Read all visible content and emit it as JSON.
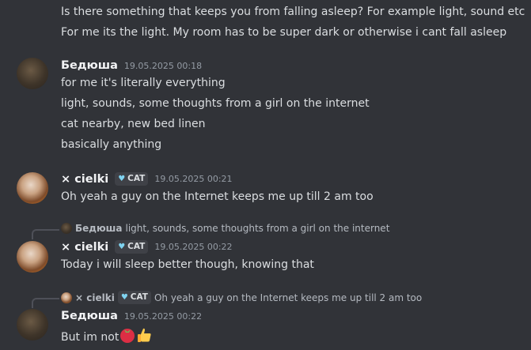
{
  "messages": {
    "top_line1": "Is there something that keeps you from falling asleep? For example light, sound etc",
    "top_line2": "For me its the light. My room has to be super dark or otherwise i cant fall asleep",
    "msg2": {
      "author": "Бедюша",
      "time": "19.05.2025 00:18",
      "lines": [
        "for me it's literally everything",
        "light, sounds, some thoughts from a girl on the internet",
        "cat nearby, new bed linen",
        "basically anything"
      ]
    },
    "msg3": {
      "author": "× cielki",
      "tag": "CAT",
      "time": "19.05.2025 00:21",
      "text": "Oh yeah a guy on the Internet keeps me up till 2 am too"
    },
    "msg4": {
      "reply_author": "Бедюша",
      "reply_text": "light, sounds, some thoughts from a girl on the internet",
      "author": "× cielki",
      "tag": "CAT",
      "time": "19.05.2025 00:22",
      "text": "Today i will sleep better though, knowing that"
    },
    "msg5": {
      "reply_author": "× cielki",
      "reply_tag": "CAT",
      "reply_text": "Oh yeah a guy on the Internet keeps me up till 2 am too",
      "author": "Бедюша",
      "time": "19.05.2025 00:22",
      "text": "But im not"
    }
  },
  "icons": {
    "tag_icon": "heart-shield-icon",
    "emoji1": "tomato-emoji",
    "emoji2": "thumbs-up-emoji"
  },
  "colors": {
    "background": "#313338",
    "text": "#dbdee1",
    "username": "#f2f3f5",
    "timestamp": "#949ba4"
  }
}
